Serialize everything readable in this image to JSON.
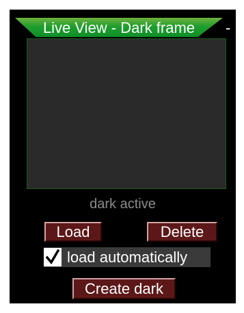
{
  "window": {
    "title": "Live View - Dark frame",
    "minimize_glyph": "-"
  },
  "status": {
    "text": "dark active"
  },
  "buttons": {
    "load_label": "Load",
    "delete_label": "Delete",
    "create_label": "Create dark"
  },
  "options": {
    "auto_load_label": "load automatically",
    "auto_load_checked": true
  },
  "icons": {
    "checkbox": "checkmark-icon"
  },
  "colors": {
    "title_bar": "#1f9e2f",
    "button_face": "#5c1818",
    "status_text": "#8c8c8c",
    "panel_background": "#000000"
  }
}
